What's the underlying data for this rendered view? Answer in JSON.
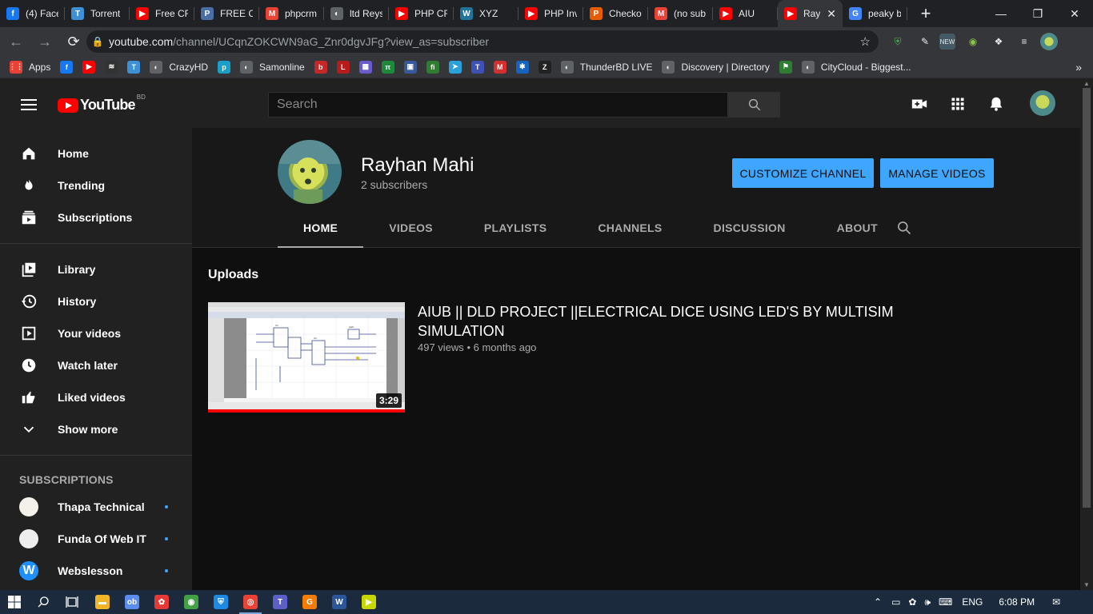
{
  "browser": {
    "tabs": [
      {
        "title": "(4) Face",
        "icon": "facebook-icon",
        "color": "#1877f2",
        "glyph": "f"
      },
      {
        "title": "Torrent",
        "icon": "torrent-icon",
        "color": "#3d8fd6",
        "glyph": "T"
      },
      {
        "title": "Free CR",
        "icon": "youtube-icon",
        "color": "#ff0000",
        "glyph": "▶"
      },
      {
        "title": "FREE CF",
        "icon": "php-icon",
        "color": "#4a6fa5",
        "glyph": "P"
      },
      {
        "title": "phpcrm",
        "icon": "gmail-icon",
        "color": "#ea4335",
        "glyph": "M"
      },
      {
        "title": "ltd Reys",
        "icon": "globe-icon",
        "color": "#5f6368",
        "glyph": "◐"
      },
      {
        "title": "PHP CR",
        "icon": "youtube-icon",
        "color": "#ff0000",
        "glyph": "▶"
      },
      {
        "title": "XYZ",
        "icon": "wordpress-icon",
        "color": "#21759b",
        "glyph": "W"
      },
      {
        "title": "PHP Inv",
        "icon": "youtube-icon",
        "color": "#ff0000",
        "glyph": "▶"
      },
      {
        "title": "Checko",
        "icon": "pis-icon",
        "color": "#e65c00",
        "glyph": "P"
      },
      {
        "title": "(no sub",
        "icon": "gmail-icon",
        "color": "#ea4335",
        "glyph": "M"
      },
      {
        "title": "AIU",
        "icon": "youtube-icon",
        "color": "#ff0000",
        "glyph": "▶"
      },
      {
        "title": "Ray",
        "icon": "youtube-icon",
        "color": "#ff0000",
        "glyph": "▶",
        "active": true
      },
      {
        "title": "peaky b",
        "icon": "google-icon",
        "color": "#4285f4",
        "glyph": "G"
      }
    ],
    "new_tab": "+",
    "url_host": "youtube.com",
    "url_path": "/channel/UCqnZOKCWN9aG_Znr0dgvJFg?view_as=subscriber",
    "bookmarks": [
      {
        "label": "Apps",
        "icon": "apps-grid-icon",
        "color": "#e94235",
        "glyph": "⋮⋮"
      },
      {
        "label": "",
        "icon": "facebook-icon",
        "color": "#1877f2",
        "glyph": "f"
      },
      {
        "label": "",
        "icon": "youtube-icon",
        "color": "#ff0000",
        "glyph": "▶"
      },
      {
        "label": "",
        "icon": "spotify-icon",
        "color": "#333",
        "glyph": "≋"
      },
      {
        "label": "",
        "icon": "torrent-icon",
        "color": "#3d8fd6",
        "glyph": "T"
      },
      {
        "label": "CrazyHD",
        "icon": "globe-icon",
        "color": "#5f6368",
        "glyph": "◐"
      },
      {
        "label": "",
        "icon": "tplink-icon",
        "color": "#19a0c9",
        "glyph": "p"
      },
      {
        "label": "Samonline",
        "icon": "globe-icon",
        "color": "#5f6368",
        "glyph": "◐"
      },
      {
        "label": "",
        "icon": "b-icon",
        "color": "#c62828",
        "glyph": "b"
      },
      {
        "label": "",
        "icon": "live-icon",
        "color": "#b71c1c",
        "glyph": "L"
      },
      {
        "label": "",
        "icon": "photo-icon",
        "color": "#6a5acd",
        "glyph": "▦"
      },
      {
        "label": "",
        "icon": "green-icon",
        "color": "#1b8a3a",
        "glyph": "π"
      },
      {
        "label": "",
        "icon": "media-icon",
        "color": "#3b5998",
        "glyph": "▣"
      },
      {
        "label": "",
        "icon": "fi-icon",
        "color": "#2e7d32",
        "glyph": "fi"
      },
      {
        "label": "",
        "icon": "telegram-icon",
        "color": "#2aa1da",
        "glyph": "➤"
      },
      {
        "label": "",
        "icon": "t-icon",
        "color": "#3f51b5",
        "glyph": "T"
      },
      {
        "label": "",
        "icon": "mega-icon",
        "color": "#d32f2f",
        "glyph": "M"
      },
      {
        "label": "",
        "icon": "gear-icon",
        "color": "#1565c0",
        "glyph": "✱"
      },
      {
        "label": "",
        "icon": "z-icon",
        "color": "#222",
        "glyph": "Z"
      },
      {
        "label": "ThunderBD LIVE",
        "icon": "globe-icon",
        "color": "#5f6368",
        "glyph": "◐"
      },
      {
        "label": "Discovery | Directory",
        "icon": "globe-icon",
        "color": "#5f6368",
        "glyph": "◐"
      },
      {
        "label": "",
        "icon": "flag-icon",
        "color": "#2e7d32",
        "glyph": "⚑"
      },
      {
        "label": "CityCloud - Biggest...",
        "icon": "globe-icon",
        "color": "#5f6368",
        "glyph": "◐"
      }
    ],
    "bookmarks_more": "»"
  },
  "youtube": {
    "logo_text": "YouTube",
    "logo_country": "BD",
    "search_placeholder": "Search",
    "guide": {
      "primary": [
        {
          "label": "Home",
          "icon": "home-icon"
        },
        {
          "label": "Trending",
          "icon": "flame-icon"
        },
        {
          "label": "Subscriptions",
          "icon": "subscriptions-icon"
        }
      ],
      "library": [
        {
          "label": "Library",
          "icon": "library-icon"
        },
        {
          "label": "History",
          "icon": "history-icon"
        },
        {
          "label": "Your videos",
          "icon": "your-videos-icon"
        },
        {
          "label": "Watch later",
          "icon": "clock-icon"
        },
        {
          "label": "Liked videos",
          "icon": "thumbs-up-icon"
        },
        {
          "label": "Show more",
          "icon": "chevron-down-icon"
        }
      ],
      "subscriptions_heading": "SUBSCRIPTIONS",
      "subscriptions": [
        {
          "label": "Thapa Technical",
          "avatar_color": "#f4f1ea",
          "avatar_fg": "#c0392b"
        },
        {
          "label": "Funda Of Web IT",
          "avatar_color": "#eeeeee",
          "avatar_fg": "#222"
        },
        {
          "label": "Webslesson",
          "avatar_color": "#1e90ff",
          "avatar_fg": "#fff",
          "avatar_text": "W"
        }
      ]
    },
    "channel": {
      "name": "Rayhan Mahi",
      "subscribers": "2 subscribers",
      "customize_label": "CUSTOMIZE CHANNEL",
      "manage_label": "MANAGE VIDEOS",
      "tabs": [
        "HOME",
        "VIDEOS",
        "PLAYLISTS",
        "CHANNELS",
        "DISCUSSION",
        "ABOUT"
      ],
      "active_tab": 0
    },
    "uploads": {
      "heading": "Uploads",
      "videos": [
        {
          "title": "AIUB || DLD PROJECT ||ELECTRICAL DICE USING LED'S BY MULTISIM SIMULATION",
          "views": "497 views",
          "separator": "•",
          "age": "6 months ago",
          "duration": "3:29",
          "watched_fraction": 1.0
        }
      ]
    }
  },
  "taskbar": {
    "language": "ENG",
    "time": "6:08 PM",
    "apps": [
      {
        "icon": "file-explorer-icon",
        "color": "#f0b429",
        "glyph": "▬"
      },
      {
        "icon": "app-ob-icon",
        "color": "#5a8dee",
        "glyph": "ob"
      },
      {
        "icon": "app-gear-icon",
        "color": "#e53935",
        "glyph": "✿"
      },
      {
        "icon": "app-globe-icon",
        "color": "#43a047",
        "glyph": "◉"
      },
      {
        "icon": "shield-icon",
        "color": "#1e88e5",
        "glyph": "⛨"
      },
      {
        "icon": "chrome-icon",
        "color": "#ea4335",
        "glyph": "◎",
        "active": true
      },
      {
        "icon": "teams-icon",
        "color": "#5b5fc7",
        "glyph": "T"
      },
      {
        "icon": "app-orange-icon",
        "color": "#f57c00",
        "glyph": "G"
      },
      {
        "icon": "word-icon",
        "color": "#2b579a",
        "glyph": "W"
      },
      {
        "icon": "app-yellow-icon",
        "color": "#c6d800",
        "glyph": "▶"
      }
    ]
  }
}
